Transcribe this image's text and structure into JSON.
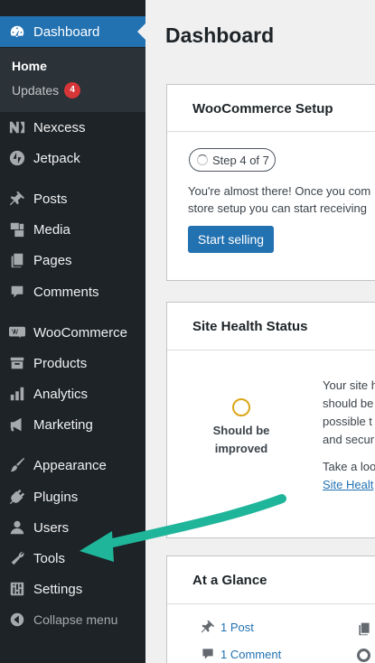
{
  "sidebar": {
    "dashboard": "Dashboard",
    "home": "Home",
    "updates": "Updates",
    "updates_count": "4",
    "items": [
      {
        "label": "Nexcess",
        "icon": "nexcess-icon"
      },
      {
        "label": "Jetpack",
        "icon": "jetpack-icon"
      },
      {
        "label": "Posts",
        "icon": "pin-icon"
      },
      {
        "label": "Media",
        "icon": "media-icon"
      },
      {
        "label": "Pages",
        "icon": "pages-icon"
      },
      {
        "label": "Comments",
        "icon": "comment-icon"
      },
      {
        "label": "WooCommerce",
        "icon": "woocommerce-icon"
      },
      {
        "label": "Products",
        "icon": "archive-icon"
      },
      {
        "label": "Analytics",
        "icon": "bar-chart-icon"
      },
      {
        "label": "Marketing",
        "icon": "megaphone-icon"
      },
      {
        "label": "Appearance",
        "icon": "paintbrush-icon"
      },
      {
        "label": "Plugins",
        "icon": "plug-icon"
      },
      {
        "label": "Users",
        "icon": "user-icon"
      },
      {
        "label": "Tools",
        "icon": "wrench-icon"
      },
      {
        "label": "Settings",
        "icon": "sliders-icon"
      }
    ],
    "collapse": "Collapse menu"
  },
  "main": {
    "title": "Dashboard",
    "woo_setup": {
      "title": "WooCommerce Setup",
      "step": "Step 4 of 7",
      "line1": "You're almost there! Once you com",
      "line2": "store setup you can start receiving",
      "button": "Start selling"
    },
    "site_health": {
      "title": "Site Health Status",
      "status": "Should be improved",
      "text_lines": [
        "Your site h",
        "should be",
        "possible t",
        "and secur"
      ],
      "take_look": "Take a loo",
      "link": "Site Healt"
    },
    "at_a_glance": {
      "title": "At a Glance",
      "posts": "1 Post",
      "comments": "1 Comment"
    }
  },
  "colors": {
    "sidebar_bg": "#1d2327",
    "active": "#2271b1",
    "arrow": "#1fb59a",
    "badge": "#d63638"
  }
}
